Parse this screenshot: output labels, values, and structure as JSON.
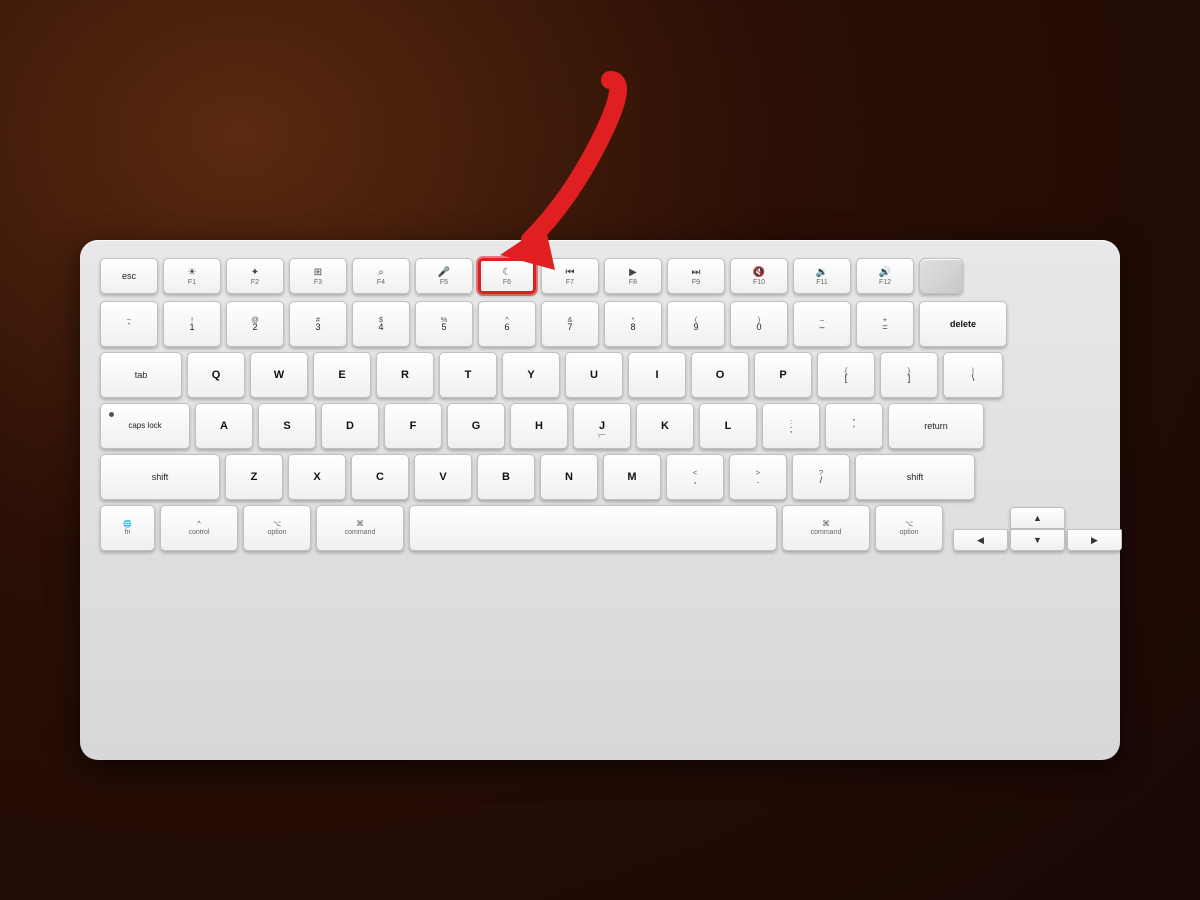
{
  "background": {
    "color": "#2a0e05"
  },
  "arrow": {
    "color": "#e02020",
    "label": "red-arrow-pointing-to-f6"
  },
  "keyboard": {
    "highlighted_key": "F6",
    "highlighted_key_description": "Do Not Disturb / Moon key",
    "rows": {
      "function_row": [
        "esc",
        "F1",
        "F2",
        "F3",
        "F4",
        "F5",
        "F6",
        "F7",
        "F8",
        "F9",
        "F10",
        "F11",
        "F12",
        "touch_id"
      ],
      "number_row": [
        "~`",
        "!1",
        "@2",
        "#3",
        "$4",
        "%5",
        "^6",
        "&7",
        "*8",
        "(9",
        ")0",
        "-_",
        "=+",
        "delete"
      ],
      "qwerty_row": [
        "tab",
        "Q",
        "W",
        "E",
        "R",
        "T",
        "Y",
        "U",
        "I",
        "O",
        "P",
        "{[",
        "}]",
        "|\\"
      ],
      "home_row": [
        "caps lock",
        "A",
        "S",
        "D",
        "F",
        "G",
        "H",
        "J",
        "K",
        "L",
        ":;",
        "\"'",
        "return"
      ],
      "shift_row": [
        "shift",
        "Z",
        "X",
        "C",
        "V",
        "B",
        "N",
        "M",
        "<,",
        ">.",
        "?/",
        "shift"
      ],
      "bottom_row": [
        "fn",
        "control",
        "option",
        "command",
        "space",
        "command",
        "option",
        "arrows"
      ]
    }
  }
}
